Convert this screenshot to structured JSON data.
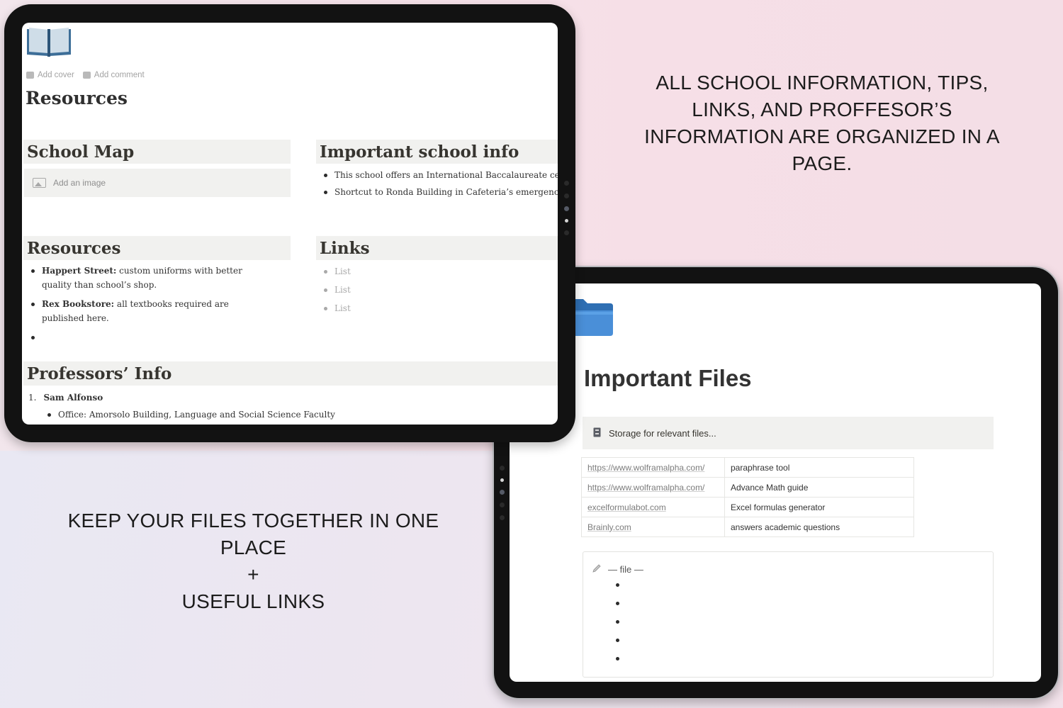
{
  "captions": {
    "right_lines": [
      "ALL SCHOOL INFORMATION, TIPS,",
      "LINKS, AND PROFFESOR’S",
      "INFORMATION ARE ORGANIZED IN A",
      "PAGE."
    ],
    "left_lines": [
      "KEEP YOUR FILES TOGETHER IN ONE",
      "PLACE",
      "+",
      "USEFUL LINKS"
    ]
  },
  "resources_page": {
    "icon": "open-book-icon",
    "add_cover": "Add cover",
    "add_comment": "Add comment",
    "title": "Resources",
    "school_map": {
      "heading": "School Map",
      "add_image": "Add an image"
    },
    "important_info": {
      "heading": "Important school info",
      "items": [
        "This school offers an International Baccalaureate certificate.",
        "Shortcut to Ronda Building in Cafeteria’s emergency exit."
      ]
    },
    "resources_section": {
      "heading": "Resources",
      "items": [
        {
          "bold": "Happert Street:",
          "text": " custom uniforms with better quality than school’s shop."
        },
        {
          "bold": "Rex Bookstore:",
          "text": " all textbooks required are published here."
        },
        {
          "bold": "",
          "text": ""
        }
      ]
    },
    "links": {
      "heading": "Links",
      "items": [
        "List",
        "List",
        "List"
      ]
    },
    "professors": {
      "heading": "Professors’ Info",
      "entries": [
        {
          "number": "1.",
          "name": "Sam Alfonso",
          "details": [
            "Office: Amorsolo Building, Language and Social Science Faculty"
          ]
        }
      ]
    }
  },
  "files_page": {
    "icon": "folder-icon",
    "title": "Important Files",
    "callout_icon": "file-cabinet-icon",
    "callout": "Storage for relevant files...",
    "links_table": [
      {
        "url": "https://www.wolframalpha.com/",
        "description": "paraphrase tool"
      },
      {
        "url": "https://www.wolframalpha.com/",
        "description": "Advance Math guide"
      },
      {
        "url": "excelformulabot.com",
        "description": "Excel formulas generator"
      },
      {
        "url": "Brainly.com",
        "description": "answers academic questions"
      }
    ],
    "file_block": {
      "icon": "pencil-icon",
      "label": "— file —",
      "bullet_count": 5
    }
  },
  "colors": {
    "accent_folder": "#4a8fd8",
    "block_bg": "#f1f1ef",
    "tablet_frame": "#121212"
  }
}
